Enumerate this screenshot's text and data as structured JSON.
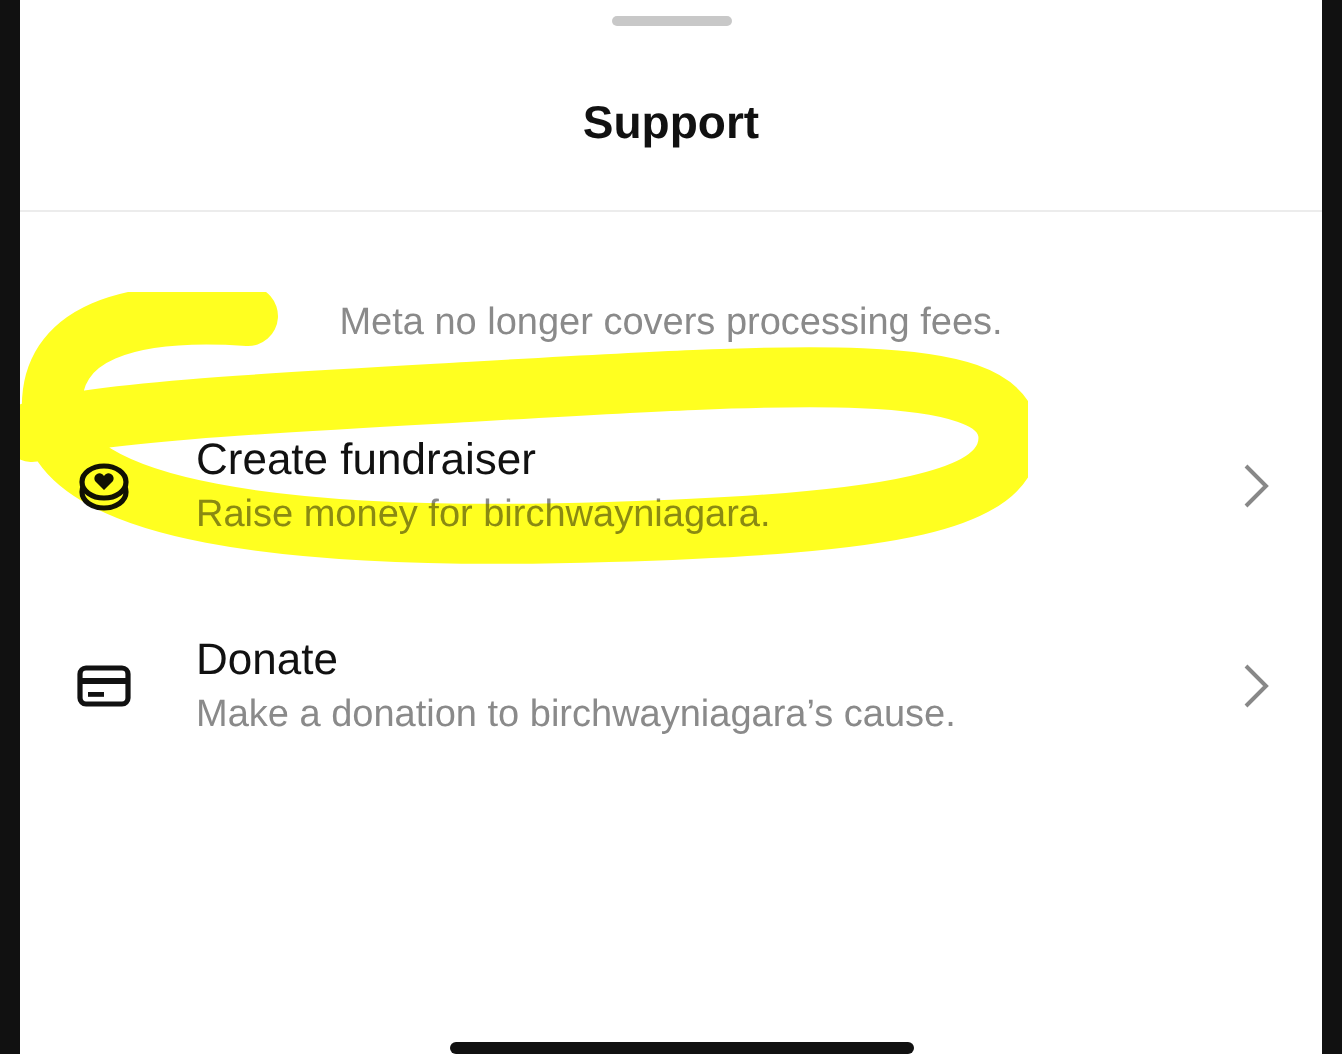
{
  "sheet": {
    "title": "Support",
    "notice": "Meta no longer covers processing fees."
  },
  "options": [
    {
      "kind": "fundraiser",
      "title": "Create fundraiser",
      "subtitle": "Raise money for birchwayniagara.",
      "highlighted": true
    },
    {
      "kind": "donate",
      "title": "Donate",
      "subtitle": "Make a donation to birchwayniagara’s cause.",
      "highlighted": false
    }
  ]
}
